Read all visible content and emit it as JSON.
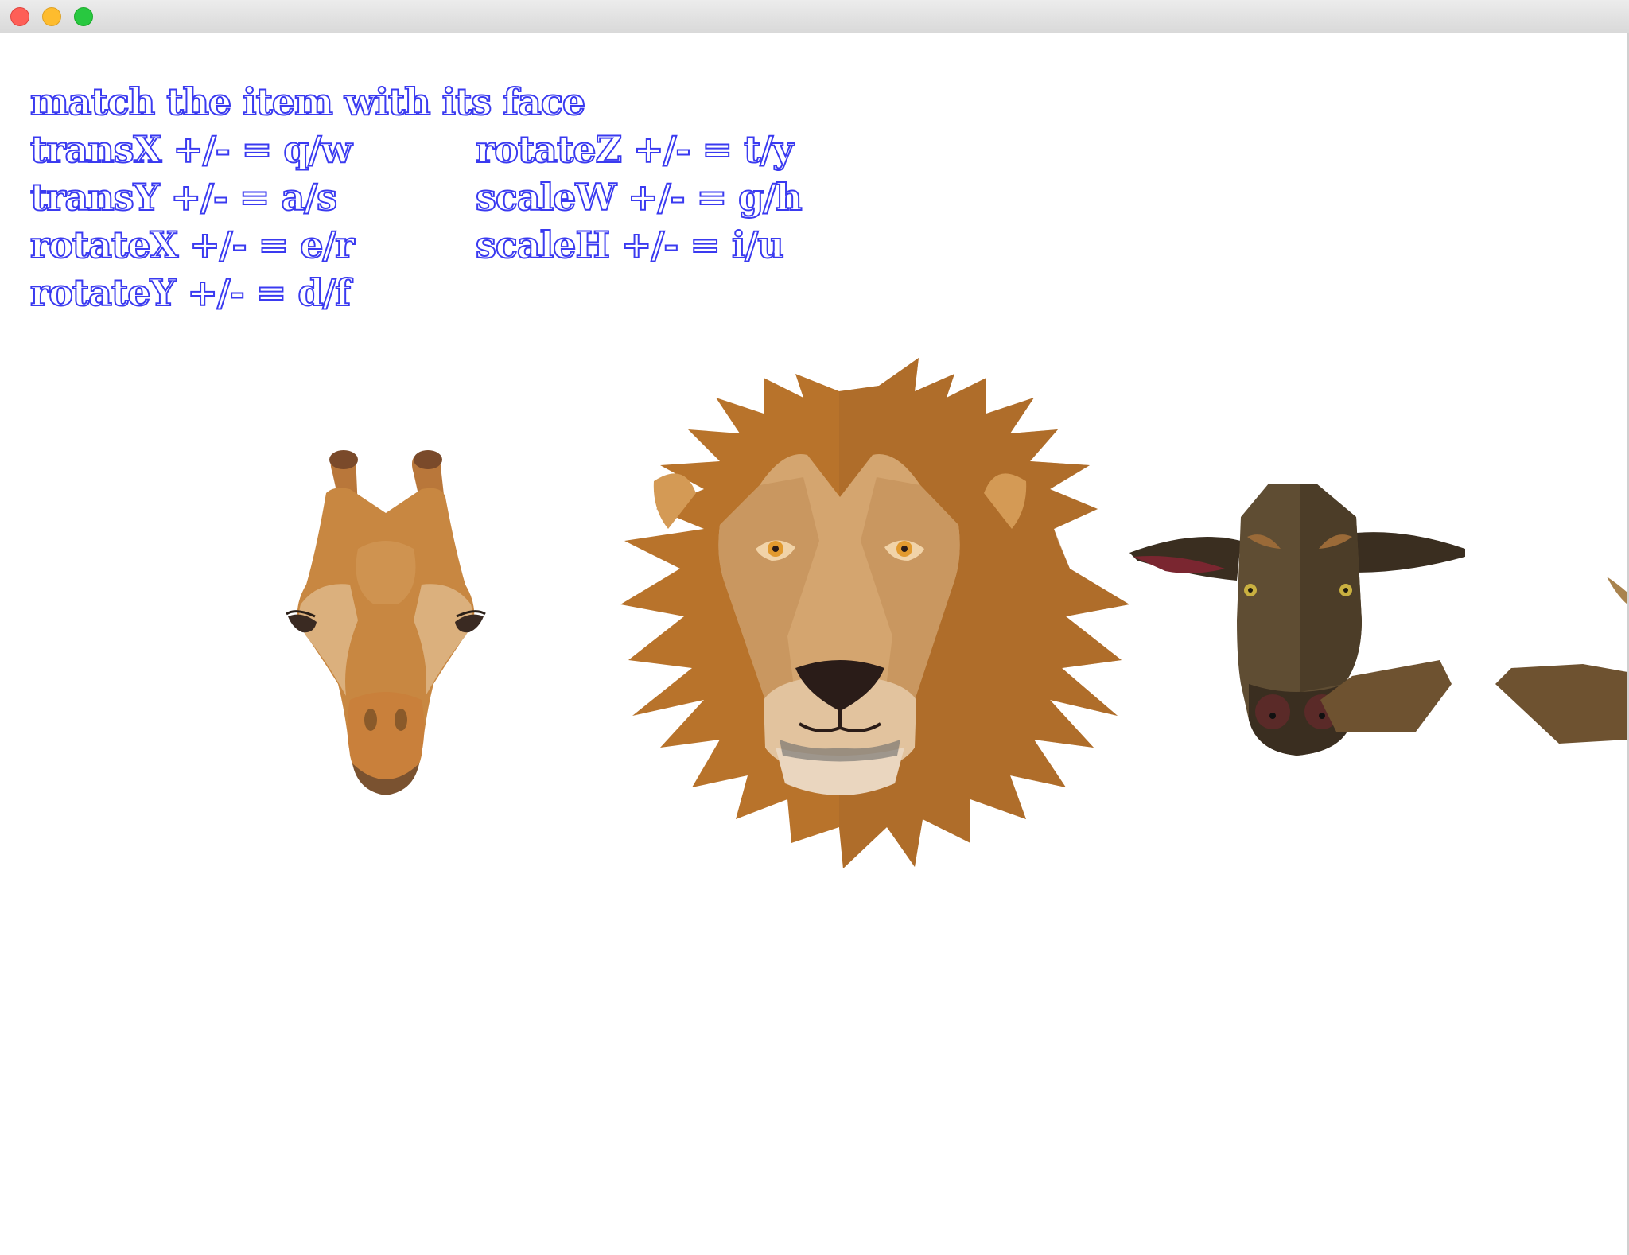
{
  "instructions": {
    "title": "match the item with its face",
    "left": [
      "transX +/- = q/w",
      "transY +/- = a/s",
      "rotateX +/- = e/r",
      "rotateY +/- = d/f"
    ],
    "right": [
      "rotateZ +/- = t/y",
      "scaleW +/- = g/h",
      "scaleH +/- = i/u"
    ]
  },
  "faces": [
    {
      "animal": "giraffe",
      "icon": "giraffe-face-icon"
    },
    {
      "animal": "lion",
      "icon": "lion-face-icon"
    },
    {
      "animal": "goat",
      "icon": "goat-face-icon"
    },
    {
      "animal": "unknown",
      "icon": "partial-face-icon"
    }
  ],
  "colors": {
    "instruction_text_stroke": "#3a3af0",
    "background": "#ffffff"
  }
}
